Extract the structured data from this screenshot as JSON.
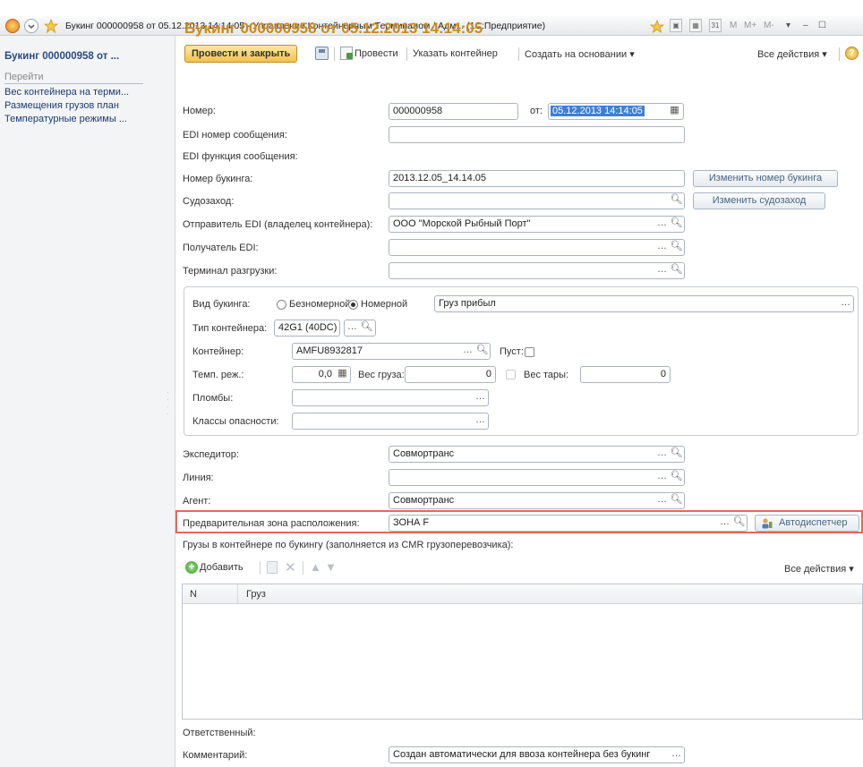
{
  "window": {
    "title": "Букинг 000000958 от 05.12.2013 14:14:05 - Управление Контейнерным Терминалом / Адм... (1С:Предприятие)",
    "calc_buttons": [
      "M",
      "M+",
      "M-"
    ]
  },
  "sidebar": {
    "title": "Букинг 000000958 от ...",
    "goto_label": "Перейти",
    "items": [
      {
        "label": "Вес контейнера на терми..."
      },
      {
        "label": "Размещения грузов план"
      },
      {
        "label": "Температурные режимы ..."
      }
    ]
  },
  "form": {
    "title": "Букинг 000000958 от 05.12.2013 14:14:05"
  },
  "toolbar": {
    "post_close": "Провести и закрыть",
    "post": "Провести",
    "specify_container": "Указать контейнер",
    "create_based_on": "Создать на основании",
    "all_actions": "Все действия"
  },
  "fields": {
    "number_label": "Номер:",
    "number_value": "000000958",
    "date_label": "от:",
    "date_value": "05.12.2013 14:14:05",
    "edi_msg_label": "EDI номер сообщения:",
    "edi_msg_value": "",
    "edi_func_label": "EDI функция сообщения:",
    "booking_no_label": "Номер букинга:",
    "booking_no_value": "2013.12.05_14.14.05",
    "change_booking_no": "Изменить номер букинга",
    "ship_call_label": "Судозаход:",
    "ship_call_value": "",
    "change_ship_call": "Изменить судозаход",
    "edi_sender_label": "Отправитель EDI (владелец контейнера):",
    "edi_sender_value": "ООО \"Морской Рыбный Порт\"",
    "edi_receiver_label": "Получатель EDI:",
    "edi_receiver_value": "",
    "unload_terminal_label": "Терминал разгрузки:",
    "unload_terminal_value": ""
  },
  "group": {
    "booking_type_label": "Вид букинга:",
    "opt_unnumbered": "Безномерной",
    "opt_numbered": "Номерной",
    "booking_type_selected": "Номерной",
    "cargo_status_value": "Груз прибыл",
    "container_type_label": "Тип контейнера:",
    "container_type_value": "42G1 (40DC)",
    "container_label": "Контейнер:",
    "container_value": "AMFU8932817",
    "empty_label": "Пуст:",
    "temp_mode_label": "Темп. реж.:",
    "temp_mode_value": "0,0",
    "cargo_weight_label": "Вес груза:",
    "cargo_weight_value": "0",
    "tare_weight_label": "Вес тары:",
    "tare_weight_value": "0",
    "seals_label": "Пломбы:",
    "seals_value": "",
    "hazard_classes_label": "Классы опасности:",
    "hazard_classes_value": ""
  },
  "lower": {
    "forwarder_label": "Экспедитор:",
    "forwarder_value": "Совмортранс",
    "line_label": "Линия:",
    "line_value": "",
    "agent_label": "Агент:",
    "agent_value": "Совмортранс",
    "pre_zone_label": "Предварительная зона расположения:",
    "pre_zone_value": "ЗОНА F",
    "autodispatcher": "Автодиспетчер",
    "cargo_section_label": "Грузы в контейнере по букингу (заполняется из CMR грузоперевозчика):",
    "add_button": "Добавить",
    "all_actions": "Все действия",
    "grid_columns": [
      "N",
      "Груз"
    ],
    "responsible_label": "Ответственный:",
    "comment_label": "Комментарий:",
    "comment_value": "Создан автоматически для ввоза контейнера без букинг"
  },
  "colors": {
    "accent_title": "#cc8a1e",
    "highlight_border": "#e06a5a",
    "primary_button": "#f2c24e",
    "link_blue": "#1d3b73"
  }
}
